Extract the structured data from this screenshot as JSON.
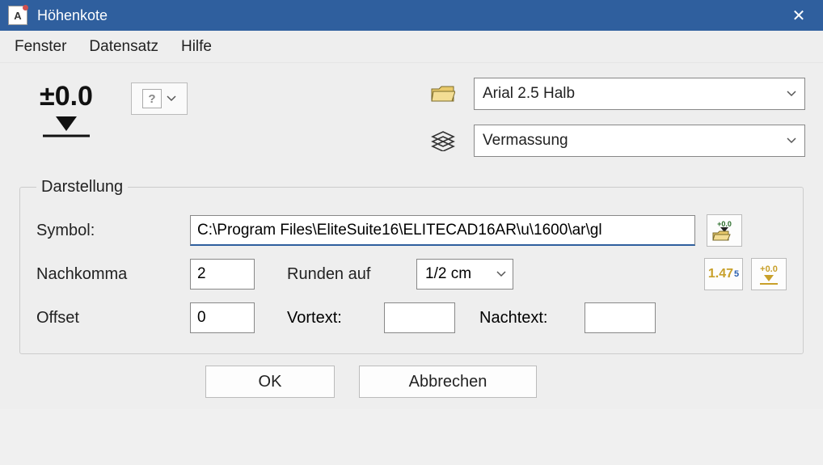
{
  "title": "Höhenkote",
  "menu": {
    "window": "Fenster",
    "dataset": "Datensatz",
    "help": "Hilfe"
  },
  "preview_text": "±0.0",
  "text_style": "Arial 2.5 Halb",
  "layer": "Vermassung",
  "group_title": "Darstellung",
  "symbol": {
    "label": "Symbol:",
    "path": "C:\\Program Files\\EliteSuite16\\ELITECAD16AR\\u\\1600\\ar\\gl"
  },
  "decimals": {
    "label": "Nachkomma",
    "value": "2"
  },
  "round": {
    "label": "Runden auf",
    "value": "1/2 cm"
  },
  "offset": {
    "label": "Offset",
    "value": "0"
  },
  "pretext": {
    "label": "Vortext:",
    "value": ""
  },
  "posttext": {
    "label": "Nachtext:",
    "value": ""
  },
  "extras_sample": "1.47",
  "extras_zero": "+0.0",
  "browse_zero": "+0.0",
  "buttons": {
    "ok": "OK",
    "cancel": "Abbrechen"
  }
}
